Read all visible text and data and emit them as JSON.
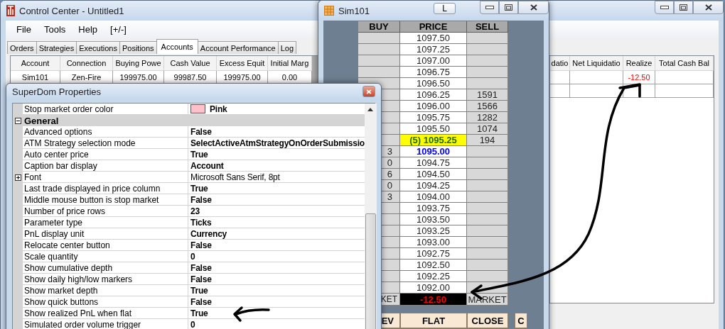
{
  "control_center": {
    "title": "Control Center - Untitled1",
    "menu": [
      "File",
      "Tools",
      "Help",
      "[+/-]"
    ],
    "tabs": [
      {
        "label": "Orders",
        "selected": false
      },
      {
        "label": "Strategies",
        "selected": false
      },
      {
        "label": "Executions",
        "selected": false
      },
      {
        "label": "Positions",
        "selected": false
      },
      {
        "label": "Accounts",
        "selected": true
      },
      {
        "label": "Account Performance",
        "selected": false
      },
      {
        "label": "Log",
        "selected": false
      }
    ],
    "grid_left": {
      "columns": [
        "Account",
        "Connection",
        "Buying Powe",
        "Cash Value",
        "Excess Equit",
        "Initial Marg"
      ],
      "rows": [
        {
          "cells": [
            "Sim101",
            "Zen-Fire",
            "199975.00",
            "99987.50",
            "199975.00",
            "0.00"
          ]
        }
      ]
    },
    "grid_right": {
      "columns": [
        "datio",
        "Net Liquidatio",
        "Realize",
        "Total Cash Bal"
      ],
      "rows": [
        {
          "cells": [
            null,
            null,
            {
              "text": "-12.50",
              "negative": true
            },
            null
          ]
        },
        {
          "cells": [
            null,
            null,
            null,
            null
          ]
        }
      ]
    }
  },
  "dom_window": {
    "title": "Sim101",
    "lock_button": "L",
    "columns": [
      "BUY",
      "PRICE",
      "SELL"
    ],
    "rows": [
      {
        "price": "1097.50",
        "kind": "plain"
      },
      {
        "price": "1097.25",
        "kind": "plain"
      },
      {
        "price": "1097.00",
        "kind": "plain"
      },
      {
        "price": "1096.75",
        "kind": "plain"
      },
      {
        "price": "1096.50",
        "kind": "plain"
      },
      {
        "price": "1096.25",
        "sell": "1591",
        "kind": "plain"
      },
      {
        "price": "1096.00",
        "sell": "1566",
        "kind": "plain"
      },
      {
        "price": "1095.75",
        "sell": "1282",
        "kind": "plain"
      },
      {
        "price": "1095.50",
        "sell": "1074",
        "kind": "plain"
      },
      {
        "price": "(5) 1095.25",
        "sell": "194",
        "kind": "last"
      },
      {
        "price": "1095.00",
        "buy": "3",
        "kind": "bid"
      },
      {
        "price": "1094.75",
        "buy": "0",
        "kind": "plain"
      },
      {
        "price": "1094.50",
        "buy": "6",
        "kind": "plain"
      },
      {
        "price": "1094.25",
        "buy": "0",
        "kind": "plain"
      },
      {
        "price": "1094.00",
        "buy": "3",
        "kind": "plain"
      },
      {
        "price": "1093.75",
        "kind": "plain"
      },
      {
        "price": "1093.50",
        "kind": "plain"
      },
      {
        "price": "1093.25",
        "kind": "plain"
      },
      {
        "price": "1093.00",
        "kind": "plain"
      },
      {
        "price": "1092.75",
        "kind": "plain"
      },
      {
        "price": "1092.50",
        "kind": "plain"
      },
      {
        "price": "1092.25",
        "kind": "plain"
      },
      {
        "price": "1092.00",
        "kind": "plain"
      }
    ],
    "pnl_row": {
      "buy": "KET",
      "pnl": "-12.50",
      "sell": "MARKET"
    },
    "buttons": [
      "EV",
      "FLAT",
      "CLOSE",
      "C"
    ]
  },
  "properties": {
    "title": "SuperDom Properties",
    "rows": [
      {
        "kind": "property",
        "name": "Stop market order color",
        "value": "Pink",
        "modified": true,
        "color": "#ffc0cb"
      },
      {
        "kind": "category",
        "name": "General",
        "expanded": true
      },
      {
        "kind": "property",
        "name": "Advanced options",
        "value": "False",
        "modified": true
      },
      {
        "kind": "property",
        "name": "ATM Strategy selection mode",
        "value": "SelectActiveAtmStrategyOnOrderSubmissio",
        "modified": true
      },
      {
        "kind": "property",
        "name": "Auto center price",
        "value": "True",
        "modified": true
      },
      {
        "kind": "property",
        "name": "Caption bar display",
        "value": "Account",
        "modified": true
      },
      {
        "kind": "property",
        "name": "Font",
        "value": "Microsoft Sans Serif, 8pt",
        "modified": false,
        "expanded": false
      },
      {
        "kind": "property",
        "name": "Last trade displayed in price column",
        "value": "True",
        "modified": true
      },
      {
        "kind": "property",
        "name": "Middle mouse button is stop market",
        "value": "False",
        "modified": true
      },
      {
        "kind": "property",
        "name": "Number of price rows",
        "value": "23",
        "modified": true
      },
      {
        "kind": "property",
        "name": "Parameter type",
        "value": "Ticks",
        "modified": true
      },
      {
        "kind": "property",
        "name": "PnL display unit",
        "value": "Currency",
        "modified": true
      },
      {
        "kind": "property",
        "name": "Relocate center button",
        "value": "False",
        "modified": true
      },
      {
        "kind": "property",
        "name": "Scale quantity",
        "value": "0",
        "modified": true
      },
      {
        "kind": "property",
        "name": "Show cumulative depth",
        "value": "False",
        "modified": true
      },
      {
        "kind": "property",
        "name": "Show daily high/low markers",
        "value": "False",
        "modified": true
      },
      {
        "kind": "property",
        "name": "Show market depth",
        "value": "True",
        "modified": true
      },
      {
        "kind": "property",
        "name": "Show quick buttons",
        "value": "False",
        "modified": true
      },
      {
        "kind": "property",
        "name": "Show realized PnL when flat",
        "value": "True",
        "modified": true
      },
      {
        "kind": "property",
        "name": "Simulated order volume trigger",
        "value": "0",
        "modified": true
      }
    ]
  }
}
